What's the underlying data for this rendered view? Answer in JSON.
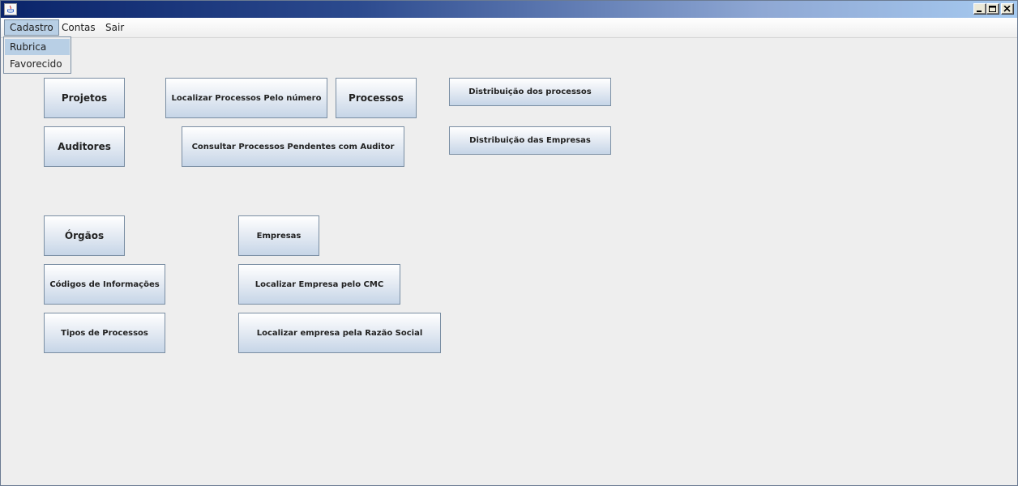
{
  "menubar": {
    "items": [
      "Cadastro",
      "Contas",
      "Sair"
    ]
  },
  "dropdown": {
    "items": [
      "Rubrica",
      "Favorecido"
    ]
  },
  "buttons": {
    "projetos": "Projetos",
    "localizar_processos": "Localizar Processos Pelo número",
    "processos": "Processos",
    "distribuicao_processos": "Distribuição dos processos",
    "auditores": "Auditores",
    "consultar_pendentes": "Consultar Processos Pendentes com Auditor",
    "distribuicao_empresas": "Distribuição das Empresas",
    "orgaos": "Órgãos",
    "empresas": "Empresas",
    "codigos_informacoes": "Códigos de Informações",
    "localizar_empresa_cmc": "Localizar Empresa pelo CMC",
    "tipos_processos": "Tipos de Processos",
    "localizar_empresa_razao": "Localizar empresa pela Razão Social"
  },
  "colors": {
    "title_gradient_start": "#0a246a",
    "title_gradient_end": "#a6caf0",
    "menu_highlight": "#b8cfe5",
    "button_border": "#7a8ea3"
  }
}
